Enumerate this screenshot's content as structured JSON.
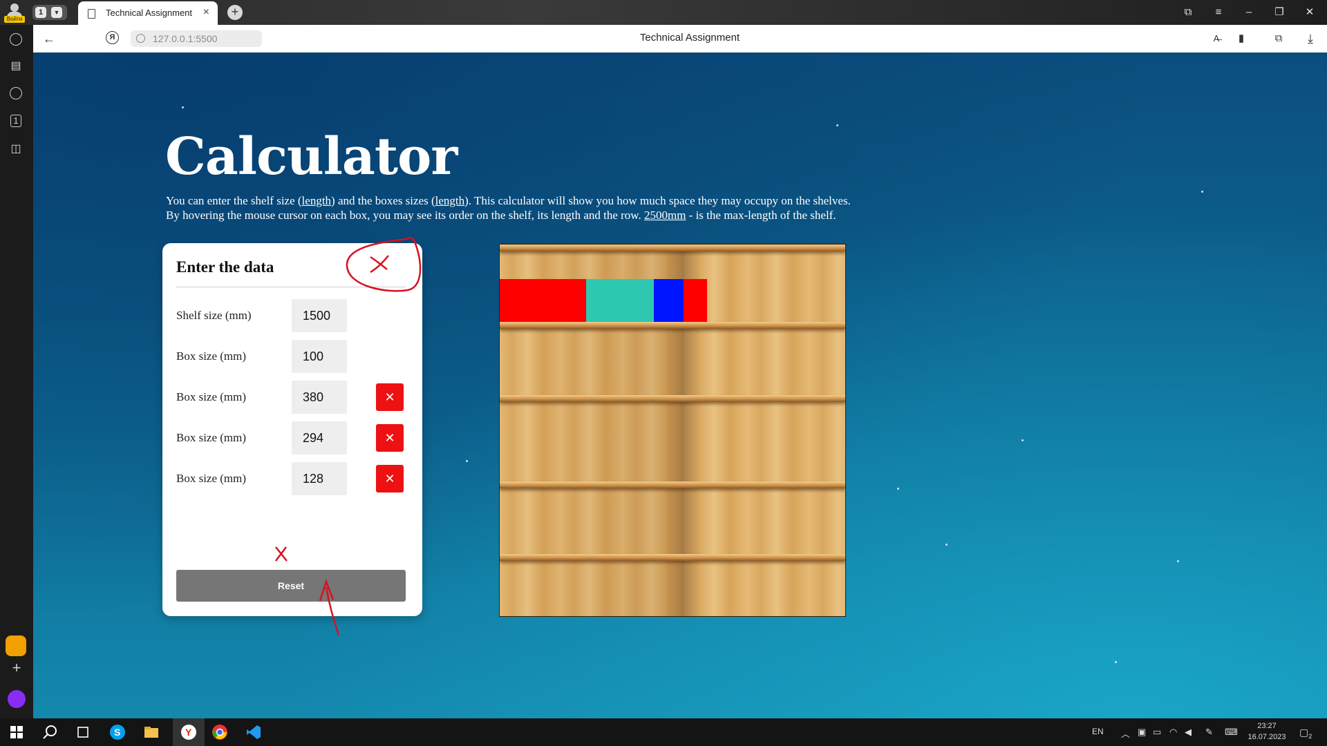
{
  "browser": {
    "tab_title": "Technical Assignment",
    "tab_group_count": "1",
    "profile_label": "Войти",
    "url": "127.0.0.1:5500",
    "page_title": "Technical Assignment"
  },
  "page": {
    "heading": "Calculator",
    "desc_line1_a": "You can enter the shelf size (",
    "desc_line1_link1": "length",
    "desc_line1_b": ") and the boxes sizes (",
    "desc_line1_link2": "length",
    "desc_line1_c": "). This calculator will show you how much space they may occupy on the shelves.",
    "desc_line2_a": "By hovering the mouse cursor on each box, you may see its order on the shelf, its length and the row. ",
    "desc_line2_link": "2500mm",
    "desc_line2_b": " - is the max-length of the shelf."
  },
  "form": {
    "title": "Enter the data",
    "rows": [
      {
        "label": "Shelf size (mm)",
        "value": "1500"
      },
      {
        "label": "Box size (mm)",
        "value": "100"
      },
      {
        "label": "Box size (mm)",
        "value": "380"
      },
      {
        "label": "Box size (mm)",
        "value": "294"
      },
      {
        "label": "Box size (mm)",
        "value": "128"
      }
    ],
    "delete_glyph": "✕",
    "reset_label": "Reset"
  },
  "shelf": {
    "boxes": [
      {
        "color": "#ff0000",
        "fraction": 0.25
      },
      {
        "color": "#2ec9b0",
        "fraction": 0.196
      },
      {
        "color": "#0015ff",
        "fraction": 0.085
      },
      {
        "color": "#ff0000",
        "fraction": 0.067
      }
    ]
  },
  "taskbar": {
    "lang": "EN",
    "time": "23:27",
    "date": "16.07.2023",
    "notifications": "2"
  }
}
